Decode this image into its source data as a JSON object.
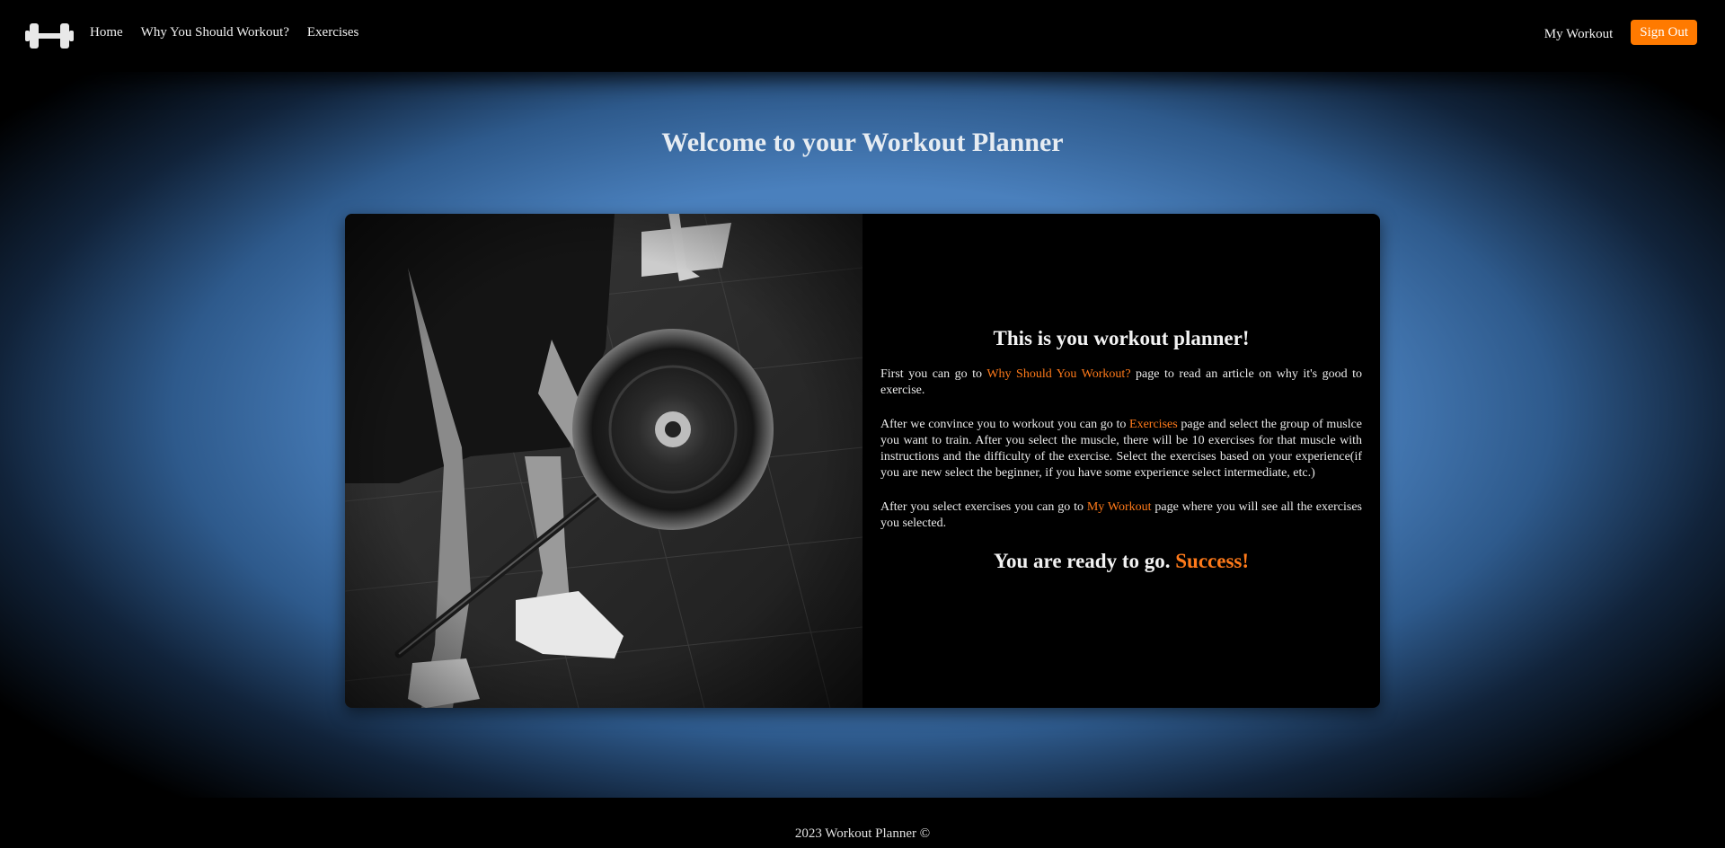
{
  "nav": {
    "logo_icon": "dumbbell-icon",
    "links": [
      "Home",
      "Why You Should Workout?",
      "Exercises"
    ],
    "my_workout": "My Workout",
    "sign_out": "Sign Out"
  },
  "main": {
    "title": "Welcome to your Workout Planner",
    "image_icon": "deadlift-photo",
    "heading": "This is you workout planner!",
    "p1": {
      "before": "First you can go to ",
      "link": "Why Should You Workout?",
      "after": " page to read an article on why it's good to exercise."
    },
    "p2": {
      "before": "After we convince you to workout you can go to ",
      "link": "Exercises",
      "after": " page and select the group of muslce you want to train. After you select the muscle, there will be 10 exercises for that muscle with instructions and the difficulty of the exercise. Select the exercises based on your experience(if you are new select the beginner, if you have some experience select intermediate, etc.)"
    },
    "p3": {
      "before": "After you select exercises you can go to ",
      "link": "My Workout",
      "after": " page where you will see all the exercises you selected."
    },
    "closing": "You are ready to go. ",
    "closing_accent": "Success!"
  },
  "footer": {
    "text": "2023 Workout Planner ©"
  },
  "colors": {
    "accent": "#ff7a00",
    "background_blue": "#4a80bd",
    "bar": "#000000"
  }
}
